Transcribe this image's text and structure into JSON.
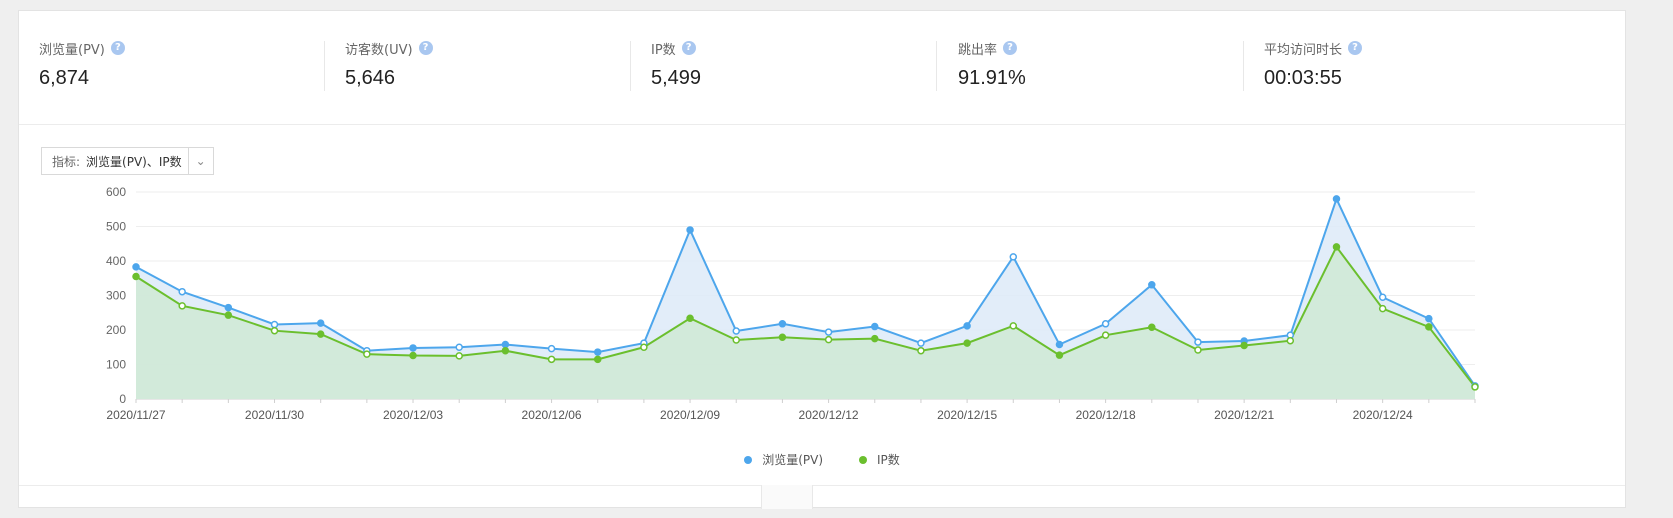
{
  "stats": [
    {
      "label": "浏览量(PV)",
      "value": "6,874"
    },
    {
      "label": "访客数(UV)",
      "value": "5,646"
    },
    {
      "label": "IP数",
      "value": "5,499"
    },
    {
      "label": "跳出率",
      "value": "91.91%"
    },
    {
      "label": "平均访问时长",
      "value": "00:03:55"
    }
  ],
  "help_glyph": "?",
  "selector": {
    "label": "指标:",
    "value": "浏览量(PV)、IP数",
    "arrow": "⌄"
  },
  "chart_data": {
    "type": "area",
    "x": [
      "2020/11/27",
      "2020/11/28",
      "2020/11/29",
      "2020/11/30",
      "2020/12/01",
      "2020/12/02",
      "2020/12/03",
      "2020/12/04",
      "2020/12/05",
      "2020/12/06",
      "2020/12/07",
      "2020/12/08",
      "2020/12/09",
      "2020/12/10",
      "2020/12/11",
      "2020/12/12",
      "2020/12/13",
      "2020/12/14",
      "2020/12/15",
      "2020/12/16",
      "2020/12/17",
      "2020/12/18",
      "2020/12/19",
      "2020/12/20",
      "2020/12/21",
      "2020/12/22",
      "2020/12/23",
      "2020/12/24",
      "2020/12/25",
      "2020/12/26"
    ],
    "x_tick_labels": [
      "2020/11/27",
      "2020/11/30",
      "2020/12/03",
      "2020/12/06",
      "2020/12/09",
      "2020/12/12",
      "2020/12/15",
      "2020/12/18",
      "2020/12/21",
      "2020/12/24"
    ],
    "yticks": [
      0,
      100,
      200,
      300,
      400,
      500,
      600
    ],
    "ylim": [
      0,
      600
    ],
    "series": [
      {
        "name": "浏览量(PV)",
        "color": "#4da6ec",
        "fill": "#ddeaf8",
        "values": [
          383,
          311,
          265,
          216,
          220,
          140,
          148,
          150,
          158,
          146,
          136,
          162,
          490,
          197,
          218,
          194,
          210,
          162,
          212,
          412,
          158,
          218,
          331,
          165,
          168,
          185,
          580,
          295,
          233,
          38
        ]
      },
      {
        "name": "IP数",
        "color": "#6bbf2e",
        "fill": "#cfe9d5",
        "values": [
          355,
          270,
          243,
          198,
          188,
          130,
          126,
          125,
          140,
          115,
          115,
          150,
          234,
          171,
          179,
          172,
          175,
          140,
          162,
          212,
          127,
          185,
          208,
          142,
          155,
          169,
          441,
          262,
          209,
          35
        ]
      }
    ],
    "grid": true,
    "legend_position": "bottom-center"
  }
}
